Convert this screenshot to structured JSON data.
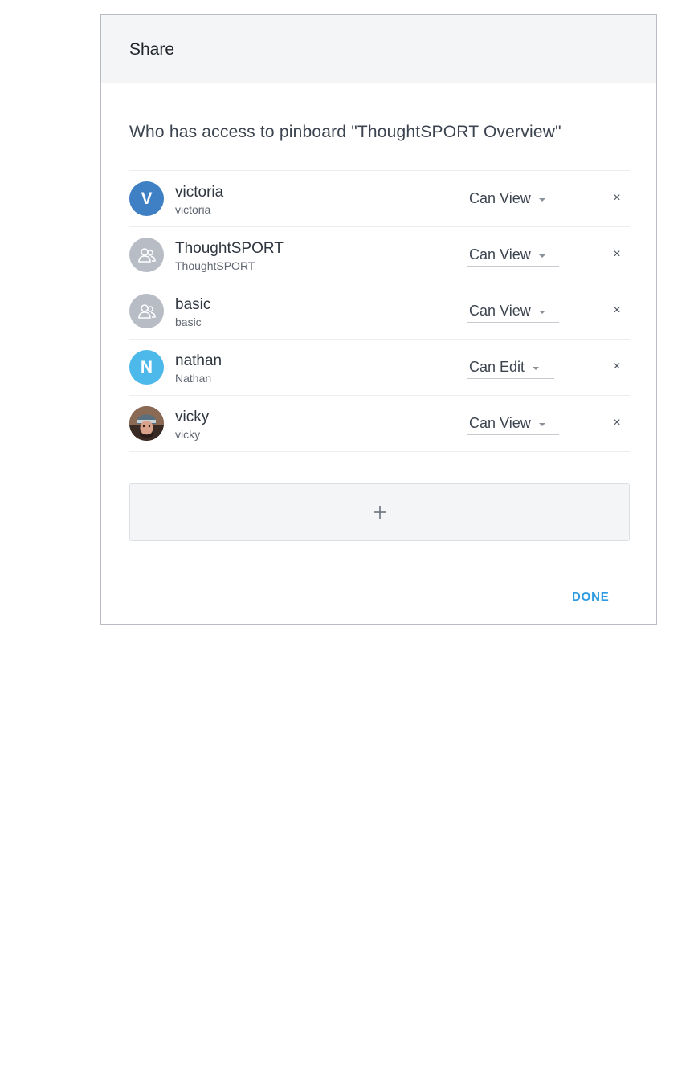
{
  "dialog": {
    "title": "Share",
    "access_heading": "Who has access to  pinboard \"ThoughtSPORT Overview\"",
    "done_label": "DONE",
    "add_icon": "plus-icon",
    "remove_glyph": "×"
  },
  "shares": [
    {
      "name": "victoria",
      "sub": "victoria",
      "avatar_type": "letter",
      "avatar_letter": "V",
      "avatar_color": "#3f7fc4",
      "permission": "Can View"
    },
    {
      "name": "ThoughtSPORT",
      "sub": "ThoughtSPORT",
      "avatar_type": "group",
      "avatar_icon": "group-icon",
      "avatar_color": "#b7bcc5",
      "permission": "Can View"
    },
    {
      "name": "basic",
      "sub": "basic",
      "avatar_type": "group",
      "avatar_icon": "group-icon",
      "avatar_color": "#b7bcc5",
      "permission": "Can View"
    },
    {
      "name": "nathan",
      "sub": "Nathan",
      "avatar_type": "letter",
      "avatar_letter": "N",
      "avatar_color": "#4db8ea",
      "permission": "Can Edit"
    },
    {
      "name": "vicky",
      "sub": "vicky",
      "avatar_type": "photo",
      "avatar_icon": "user-photo",
      "permission": "Can View"
    }
  ],
  "colors": {
    "accent": "#2d9be2",
    "header_bg": "#f4f5f7"
  }
}
